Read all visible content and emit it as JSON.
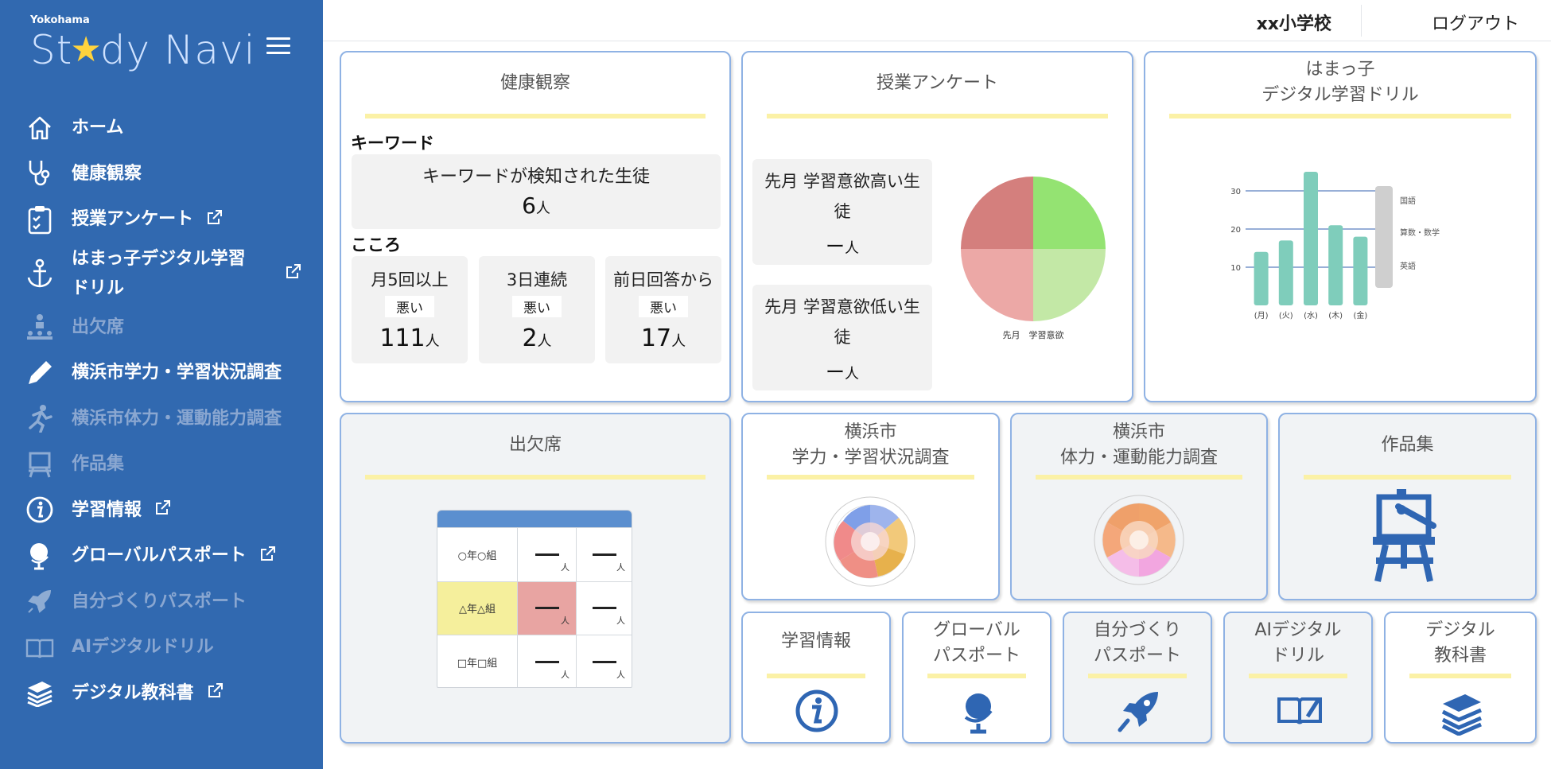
{
  "brand": {
    "small": "Yokohama",
    "main_pre": "St",
    "main_post": "dy Navi"
  },
  "sidebar": {
    "items": [
      {
        "label": "ホーム",
        "icon": "home-icon"
      },
      {
        "label": "健康観察",
        "icon": "stethoscope-icon"
      },
      {
        "label": "授業アンケート",
        "icon": "clipboard-icon",
        "external": true
      },
      {
        "label": "はまっ子デジタル学習ドリル",
        "icon": "anchor-icon",
        "external": true
      },
      {
        "label": "出欠席",
        "icon": "attendance-icon",
        "disabled": true
      },
      {
        "label": "横浜市学力・学習状況調査",
        "icon": "pencil-icon"
      },
      {
        "label": "横浜市体力・運動能力調査",
        "icon": "runner-icon",
        "disabled": true
      },
      {
        "label": "作品集",
        "icon": "easel-icon",
        "disabled": true
      },
      {
        "label": "学習情報",
        "icon": "info-icon",
        "external": true
      },
      {
        "label": "グローバルパスポート",
        "icon": "globe-icon",
        "external": true
      },
      {
        "label": "自分づくりパスポート",
        "icon": "rocket-icon",
        "disabled": true
      },
      {
        "label": "AIデジタルドリル",
        "icon": "book-pen-icon",
        "disabled": true
      },
      {
        "label": "デジタル教科書",
        "icon": "books-icon",
        "external": true
      }
    ]
  },
  "header": {
    "school": "xx小学校",
    "logout": "ログアウト"
  },
  "health": {
    "title": "健康観察",
    "keyword_label": "キーワード",
    "keyword_text": "キーワードが検知された生徒",
    "keyword_count": "6",
    "unit": "人",
    "kokoro_label": "こころ",
    "kokoro": [
      {
        "label": "月5回以上",
        "bad": "悪い",
        "count": "111"
      },
      {
        "label": "3日連続",
        "bad": "悪い",
        "count": "2"
      },
      {
        "label": "前日回答から",
        "bad": "悪い",
        "count": "17"
      }
    ]
  },
  "survey": {
    "title": "授業アンケート",
    "high_line1": "先月 学習意欲高い生",
    "high_line2": "徒",
    "low_line1": "先月 学習意欲低い生",
    "low_line2": "徒",
    "count_dash": "ー",
    "unit": "人",
    "pie_caption": "先月　学習意欲",
    "colors": {
      "q1": "#94e372",
      "q2": "#c3e8a6",
      "q3": "#eca8a6",
      "q4": "#d47f7d"
    }
  },
  "drill": {
    "title_line1": "はまっ子",
    "title_line2": "デジタル学習ドリル",
    "legend": [
      "国語",
      "算数・数学",
      "英語"
    ],
    "bar_color": "#7fcdbb"
  },
  "chart_data": {
    "type": "bar",
    "categories": [
      "(月)",
      "(火)",
      "(水)",
      "(木)",
      "(金)"
    ],
    "values": [
      14,
      17,
      35,
      21,
      18
    ],
    "xlabel": "",
    "ylabel": "",
    "yticks": [
      10,
      20,
      30
    ],
    "ylim": [
      0,
      35
    ],
    "legend": [
      "国語",
      "算数・数学",
      "英語"
    ],
    "grid": true
  },
  "attendance": {
    "title": "出欠席",
    "unit": "人",
    "rows": [
      {
        "label": "○年○組"
      },
      {
        "label": "△年△組",
        "highlight": true
      },
      {
        "label": "□年□組"
      }
    ]
  },
  "gakuryoku": {
    "title_line1": "横浜市",
    "title_line2": "学力・学習状況調査"
  },
  "tairyoku": {
    "title_line1": "横浜市",
    "title_line2": "体力・運動能力調査"
  },
  "sakuhin": {
    "title": "作品集"
  },
  "small_cards": [
    {
      "line1": "学習情報",
      "line2": "",
      "icon": "info-icon"
    },
    {
      "line1": "グローバル",
      "line2": "パスポート",
      "icon": "globe-icon"
    },
    {
      "line1": "自分づくり",
      "line2": "パスポート",
      "icon": "rocket-icon"
    },
    {
      "line1": "AIデジタル",
      "line2": "ドリル",
      "icon": "book-pen-icon"
    },
    {
      "line1": "デジタル",
      "line2": "教科書",
      "icon": "books-icon"
    }
  ]
}
